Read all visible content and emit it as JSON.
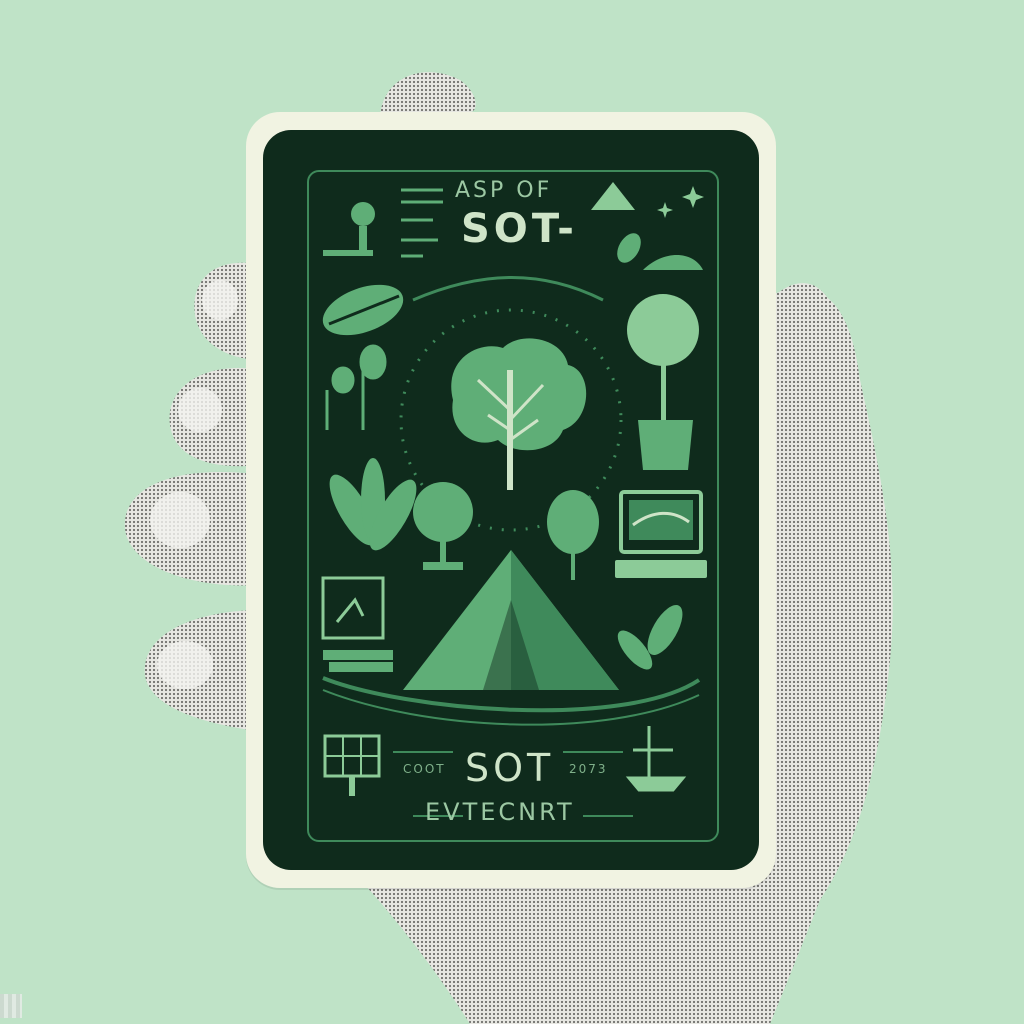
{
  "card": {
    "title_small": "ASP OF",
    "title_big": "SOT-",
    "bottom_big": "SOT",
    "bottom_left": "COOT",
    "bottom_right": "2073",
    "footer": "EVTECNRT"
  },
  "colors": {
    "background": "#bfe3c7",
    "card_border": "#f1f3e2",
    "card_face": "#0f2b1c",
    "accent_green": "#5fae77",
    "light_green": "#8ccb98"
  },
  "icons": [
    "tree-icon",
    "tent-icon",
    "potted-plant-icon",
    "laptop-icon",
    "leaf-icon",
    "solar-panel-icon",
    "mountain-icon"
  ]
}
